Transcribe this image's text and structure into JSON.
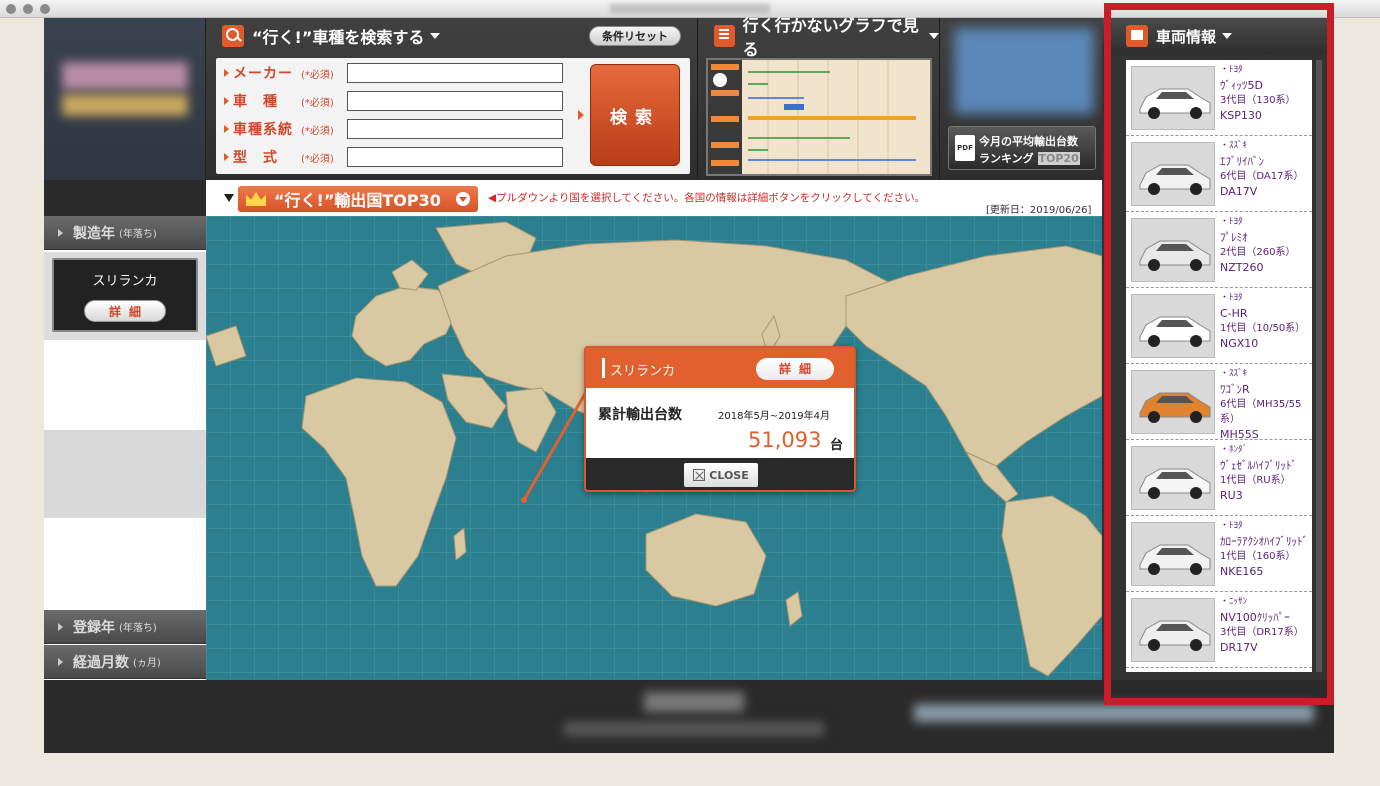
{
  "search": {
    "title": "“行く!”車種を検索する",
    "reset_label": "条件リセット",
    "fields": [
      {
        "label": "メーカー",
        "required": "(*必須)",
        "value": ""
      },
      {
        "label": "車　種",
        "required": "(*必須)",
        "value": ""
      },
      {
        "label": "車種系統",
        "required": "(*必須)",
        "value": ""
      },
      {
        "label": "型　式",
        "required": "(*必須)",
        "value": ""
      }
    ],
    "search_button": "検索"
  },
  "graph": {
    "title": "行く行かないグラフで見る"
  },
  "ranking": {
    "pdf_label": "PDF",
    "line1": "今月の平均輸出台数",
    "line2": "ランキング",
    "line2_suffix": "TOP20"
  },
  "top30": {
    "button_label": "“行く!”輸出国TOP30",
    "message": "◀プルダウンより国を選択してください。各国の情報は詳細ボタンをクリックしてください。",
    "updated": "[更新日：2019/06/26]"
  },
  "left_sidebar": {
    "tabs": [
      {
        "label": "製造年",
        "sub": "(年落ち)"
      },
      {
        "label": "登録年",
        "sub": "(年落ち)"
      },
      {
        "label": "経過月数",
        "sub": "(ヵ月)"
      }
    ],
    "selected_country": "スリランカ",
    "detail_label": "詳細"
  },
  "popup": {
    "country": "スリランカ",
    "detail_label": "詳細",
    "label": "累計輸出台数",
    "period": "2018年5月~2019年4月",
    "count": "51,093",
    "unit": "台",
    "close_label": "CLOSE"
  },
  "vehicle_panel": {
    "title": "車両情報",
    "cars": [
      {
        "maker": "・ﾄﾖﾀ",
        "model": "ｳﾞｨｯﾂ5D",
        "generation": "3代目（130系）",
        "code": "KSP130",
        "color": "#ffffff"
      },
      {
        "maker": "・ｽｽﾞｷ",
        "model": "ｴﾌﾞﾘｲﾊﾞﾝ",
        "generation": "6代目（DA17系）",
        "code": "DA17V",
        "color": "#f2f2f2"
      },
      {
        "maker": "・ﾄﾖﾀ",
        "model": "ﾌﾟﾚﾐｵ",
        "generation": "2代目（260系）",
        "code": "NZT260",
        "color": "#e8e8e8"
      },
      {
        "maker": "・ﾄﾖﾀ",
        "model": "C-HR",
        "generation": "1代目（10/50系）",
        "code": "NGX10",
        "color": "#ffffff"
      },
      {
        "maker": "・ｽｽﾞｷ",
        "model": "ﾜｺﾞﾝR",
        "generation": "6代目（MH35/55系）",
        "code": "MH55S",
        "color": "#e0832e"
      },
      {
        "maker": "・ﾎﾝﾀﾞ",
        "model": "ｳﾞｪｾﾞﾙﾊｲﾌﾞﾘｯﾄﾞ",
        "generation": "1代目（RU系）",
        "code": "RU3",
        "color": "#f5f5f5"
      },
      {
        "maker": "・ﾄﾖﾀ",
        "model": "ｶﾛｰﾗｱｸｼｵﾊｲﾌﾞﾘｯﾄﾞ",
        "generation": "1代目（160系）",
        "code": "NKE165",
        "color": "#f2f2f2"
      },
      {
        "maker": "・ﾆｯｻﾝ",
        "model": "NV100ｸﾘｯﾊﾟｰ",
        "generation": "3代目（DR17系）",
        "code": "DR17V",
        "color": "#eeeeee"
      }
    ]
  },
  "colors": {
    "accent": "#e1602e",
    "highlight": "#c81e2a",
    "map_sea": "#2b7f8e",
    "map_land": "#d8c9a3",
    "car_text": "#5a1f78"
  }
}
